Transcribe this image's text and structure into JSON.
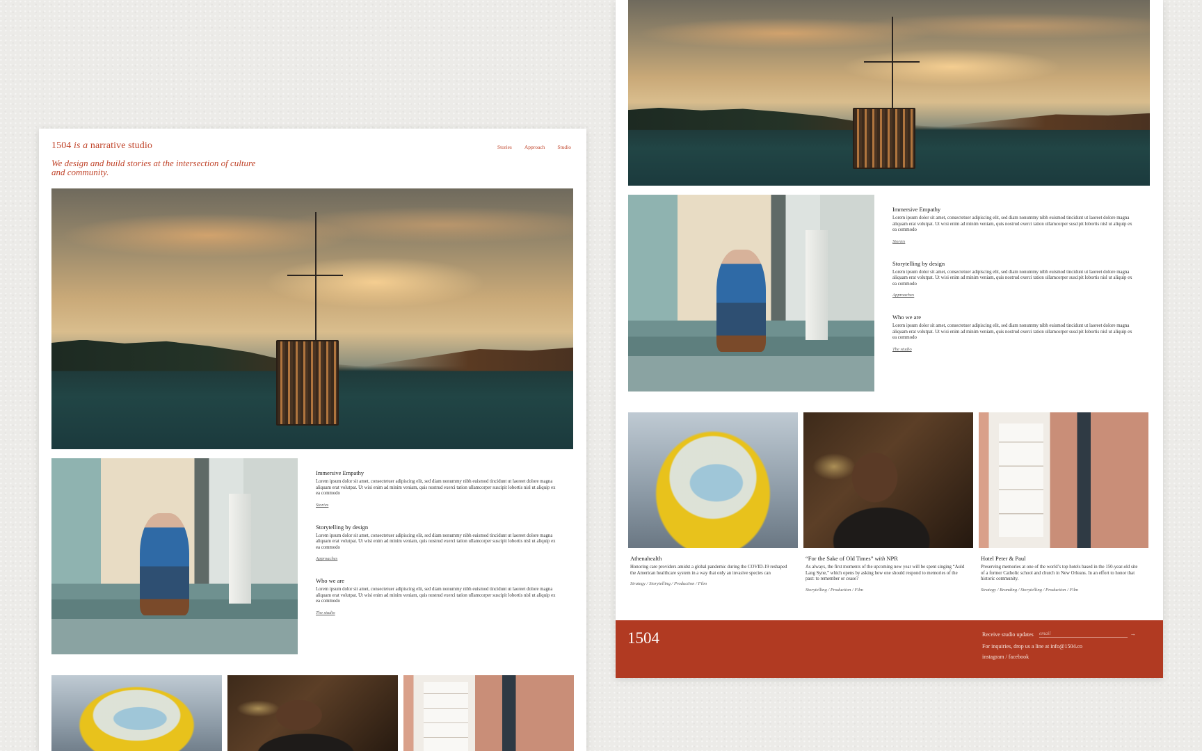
{
  "brand": {
    "name": "1504",
    "connector": "is a",
    "descriptor": "narrative studio",
    "tagline": "We design and build stories at the intersection of culture and community."
  },
  "nav": [
    "Stories",
    "Approach",
    "Studio"
  ],
  "features": [
    {
      "title": "Immersive Empathy",
      "body": "Lorem ipsum dolor sit amet, consectetuer adipiscing elit, sed diam nonummy nibh euismod tincidunt ut laoreet dolore magna aliquam erat volutpat. Ut wisi enim ad minim veniam, quis nostrud exerci tation ullamcorper suscipit lobortis nisl ut aliquip ex ea commodo",
      "link": "Stories"
    },
    {
      "title": "Storytelling by design",
      "body": "Lorem ipsum dolor sit amet, consectetuer adipiscing elit, sed diam nonummy nibh euismod tincidunt ut laoreet dolore magna aliquam erat volutpat. Ut wisi enim ad minim veniam, quis nostrud exerci tation ullamcorper suscipit lobortis nisl ut aliquip ex ea commodo",
      "link": "Approaches"
    },
    {
      "title": "Who we are",
      "body": "Lorem ipsum dolor sit amet, consectetuer adipiscing elit, sed diam nonummy nibh euismod tincidunt ut laoreet dolore magna aliquam erat volutpat. Ut wisi enim ad minim veniam, quis nostrud exerci tation ullamcorper suscipit lobortis nisl ut aliquip ex ea commodo",
      "link": "The studio"
    }
  ],
  "projects": [
    {
      "title": "Athenahealth",
      "title_suffix_italic": "",
      "title_suffix": "",
      "body": "Honoring care providers amidst a global pandemic during the COVID-19 reshaped the American healthcare system in a way that only an invasive species can",
      "tags": "Strategy / Storytelling / Production / Film"
    },
    {
      "title": "“For the Sake of Old Times”",
      "title_suffix_italic": "with",
      "title_suffix": "NPR",
      "body": "As always, the first moments of the upcoming new year will be spent singing “Auld Lang Syne,” which opens by asking how one should respond to memories of the past: to remember or cease?",
      "tags": "Storytelling / Production / Film"
    },
    {
      "title": "Hotel Peter & Paul",
      "title_suffix_italic": "",
      "title_suffix": "",
      "body": "Preserving memories at one of the world’s top hotels based in the 150-year-old site of a former Catholic school and church in New Orleans. In an effort to honor that historic community.",
      "tags": "Strategy / Branding / Storytelling / Production / Film"
    }
  ],
  "footer": {
    "logo": "1504",
    "signup_label": "Receive studio updates",
    "email_placeholder": "email",
    "arrow": "→",
    "inquiry": "For inquiries, drop us a line at info@1504.co",
    "instagram": "instagram",
    "separator": "/",
    "facebook": "facebook"
  },
  "colors": {
    "accent": "#c0442a",
    "footer_bg": "#b13a22",
    "page_bg": "#ecebe8"
  }
}
